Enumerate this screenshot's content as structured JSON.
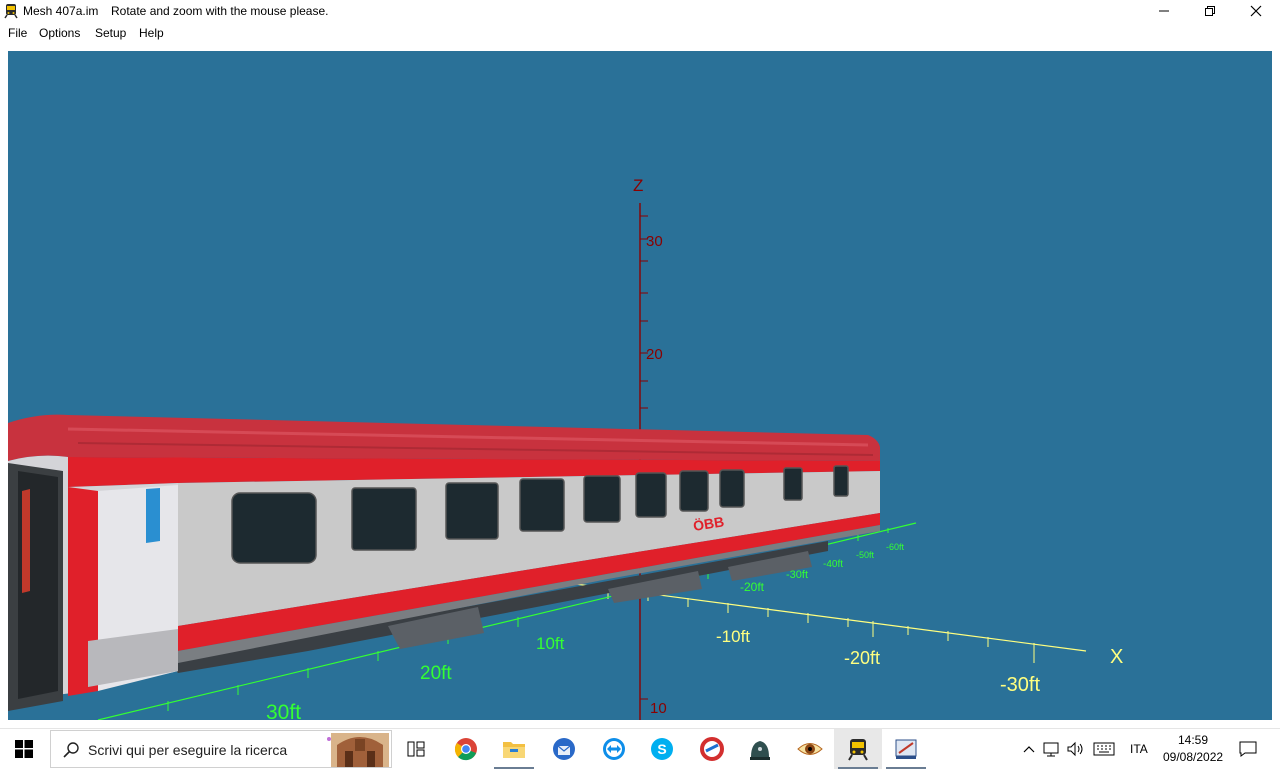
{
  "window": {
    "app_name": "Mesh 407a.im",
    "message": "Rotate and zoom with the mouse please.",
    "minimize_glyph": "—",
    "close_glyph": "✕"
  },
  "menu": [
    "File",
    "Options",
    "Setup",
    "Help"
  ],
  "scene": {
    "z_axis": {
      "label": "Z",
      "ticks": [
        "30",
        "20",
        "10"
      ]
    },
    "x_axis": {
      "label": "X",
      "ticks": [
        "-10ft",
        "-20ft",
        "-30ft"
      ]
    },
    "y_axis": {
      "ticks": [
        "10ft",
        "20ft",
        "30ft"
      ]
    },
    "far_ticks": [
      "-20ft",
      "-30ft",
      "-40ft",
      "-50ft",
      "-60ft"
    ],
    "coach": {
      "logo": "ÖBB",
      "body_color": "#c9c9c9",
      "stripe_color": "#e0202a",
      "roof_color": "#c8323e"
    },
    "colors": {
      "background": "#2a7198",
      "x_axis": "#ffff80",
      "y_axis": "#33ff33",
      "z_axis": "#8b0000"
    }
  },
  "taskbar": {
    "search_placeholder": "Scrivi qui per eseguire la ricerca",
    "apps": [
      "task-view-icon",
      "chrome-icon",
      "file-explorer-icon",
      "thunderbird-icon",
      "teamviewer-icon",
      "skype-icon",
      "ccleaner-icon",
      "app-dome-icon",
      "eye-viewer-icon",
      "train-sim-icon",
      "shape-viewer-icon"
    ],
    "language": "ITA",
    "time": "14:59",
    "date": "09/08/2022"
  }
}
